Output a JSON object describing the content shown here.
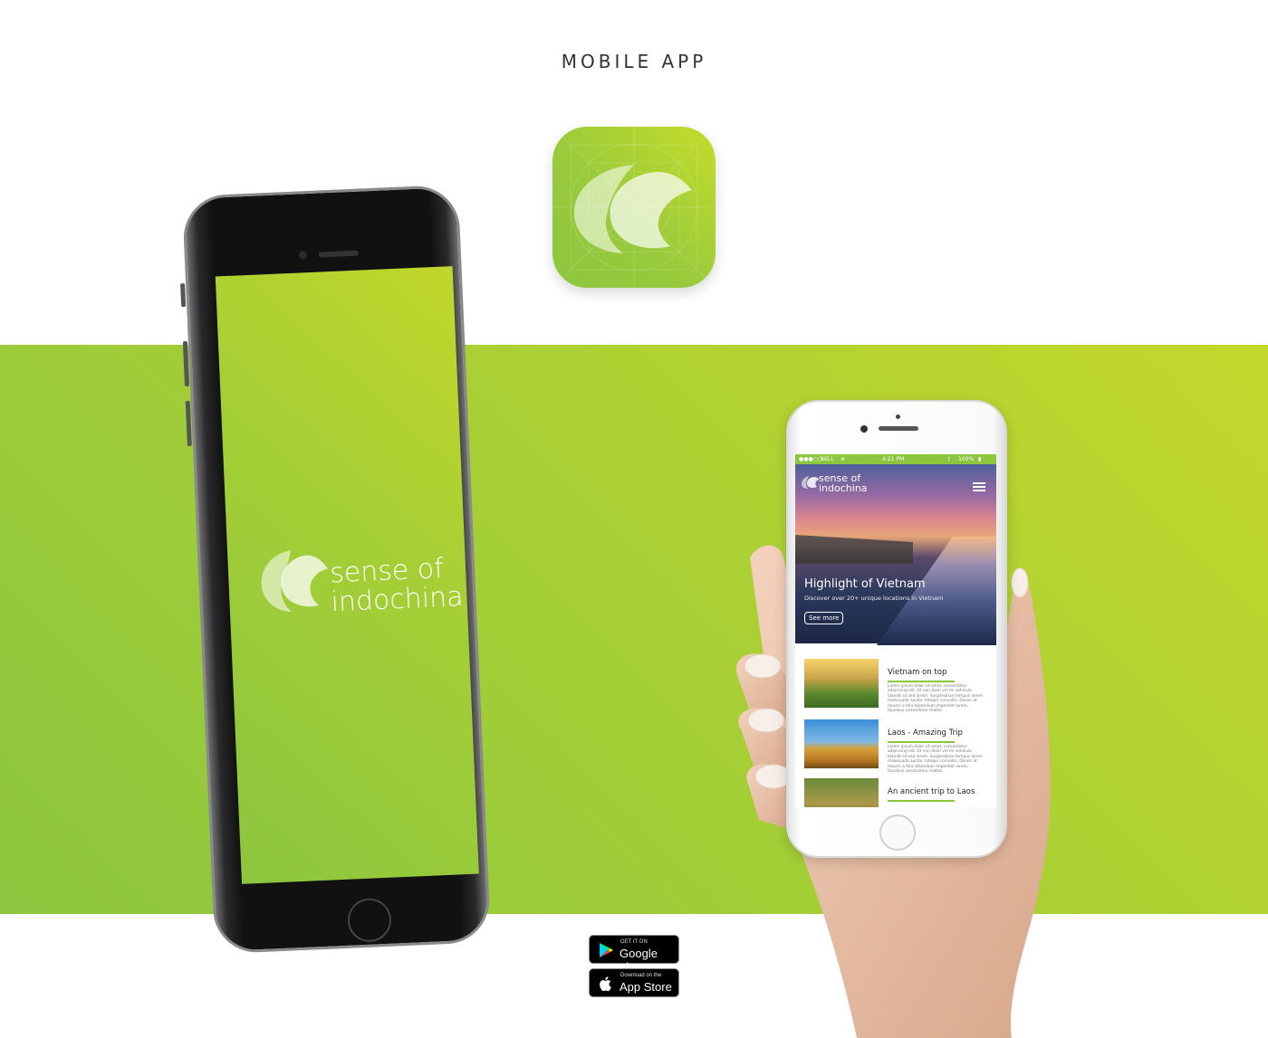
{
  "header": {
    "title": "MOBILE APP"
  },
  "brand": {
    "name_line1": "sense of",
    "name_line2": "indochina",
    "primary_color": "#8cc63f",
    "secondary_color": "#c4d82c"
  },
  "app_icon": {
    "icon": "leaf-logo-icon"
  },
  "app": {
    "status_bar": {
      "carrier": "BELL",
      "time": "4:21 PM",
      "battery": "100%"
    },
    "hero": {
      "brand_line1": "sense of",
      "brand_line2": "indochina",
      "title": "Highlight of Vietnam",
      "subtitle": "Discover over 20+ unique locations in Vietnam",
      "button": "See more"
    },
    "cards": [
      {
        "title": "Vietnam on top",
        "body": "Lorem ipsum dolor sit amet, consectetur adipiscing elit. Ut non diam vel mi vehicula blandit sit sed lorem. Suspendisse tempus lorem malesuada auctor. Integer convallis. Donec at mauris a felis bibendum imperdiet lorem, faucibus consectetur mattis."
      },
      {
        "title": "Laos - Amazing Trip",
        "body": "Lorem ipsum dolor sit amet, consectetur adipiscing elit. Ut non diam vel mi vehicula blandit sit sed lorem. Suspendisse tempus lorem malesuada auctor. Integer convallis. Donec at mauris a felis bibendum imperdiet lorem, faucibus consectetur mattis."
      },
      {
        "title": "An ancient trip to Laos",
        "body": ""
      }
    ]
  },
  "stores": {
    "google": {
      "small": "GET IT ON",
      "big": "Google play"
    },
    "apple": {
      "small": "Download on the",
      "big": "App Store"
    }
  }
}
